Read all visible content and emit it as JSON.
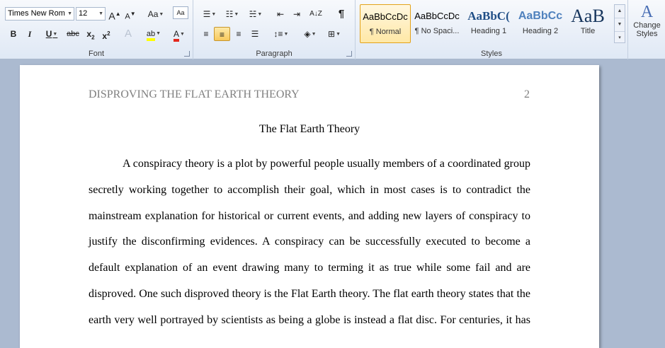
{
  "ribbon": {
    "font": {
      "label": "Font",
      "font_name": "Times New Rom",
      "font_size": "12",
      "grow_glyph": "A",
      "shrink_glyph": "A",
      "case_glyph": "Aa",
      "bold": "B",
      "italic": "I",
      "underline": "U",
      "strike": "abc",
      "subscript": "x",
      "subscript_mark": "2",
      "superscript": "x",
      "superscript_mark": "2",
      "effects_glyph": "A",
      "highlight_glyph": "ab",
      "font_color_glyph": "A",
      "highlight_color": "#ffff00",
      "font_color": "#e3271c"
    },
    "paragraph": {
      "label": "Paragraph",
      "pilcrow": "¶",
      "sort": "A↓Z"
    },
    "styles": {
      "label": "Styles",
      "items": [
        {
          "sample": "AaBbCcDc",
          "name": "¶ Normal"
        },
        {
          "sample": "AaBbCcDc",
          "name": "¶ No Spaci..."
        },
        {
          "sample": "AaBbC(",
          "name": "Heading 1"
        },
        {
          "sample": "AaBbCc",
          "name": "Heading 2"
        },
        {
          "sample": "AaB",
          "name": "Title"
        }
      ],
      "change_styles": "Change Styles",
      "change_styles_line1": "Change",
      "change_styles_line2": "Styles"
    }
  },
  "document": {
    "header": "DISPROVING THE FLAT EARTH THEORY",
    "page_number": "2",
    "title": "The Flat Earth Theory",
    "lines": [
      "A conspiracy theory is a plot by powerful people usually members  of a coordinated group",
      "secretly  working together to accomplish their goal, which in most cases is to contradict the",
      "mainstream  explanation for historical  or current events, and adding new layers of conspiracy to",
      "justify the disconfirming evidences.  A conspiracy can be successfully executed to become a",
      "default explanation of an event drawing many to terming it as true while some fail and are",
      "disproved. One such disproved theory is the Flat Earth theory. The flat earth theory states that the",
      "earth very well portrayed by scientists as being a globe is instead a flat disc. For centuries, it has"
    ]
  }
}
